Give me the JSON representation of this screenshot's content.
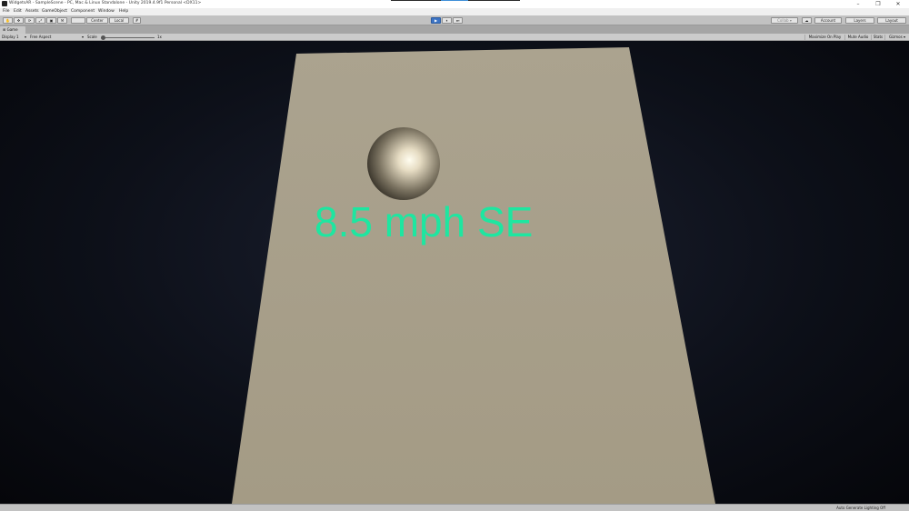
{
  "window": {
    "title": "WidgetsAR - SampleScene - PC, Mac & Linux Standalone - Unity 2019.4.9f1 Personal <DX11>",
    "controls": [
      "–",
      "❐",
      "✕"
    ]
  },
  "menu": [
    "File",
    "Edit",
    "Assets",
    "GameObject",
    "Component",
    "Window",
    "Help"
  ],
  "toolbar": {
    "tools": [
      "✋",
      "✥",
      "⟳",
      "⤢",
      "▣",
      "⚒"
    ],
    "pivot_label": "Center",
    "space_label": "Local",
    "snap_label": "#",
    "play_controls": [
      "▶",
      "⏸",
      "⏭"
    ],
    "collab_label": "Collab ▾",
    "cloud_icon": "cloud-icon",
    "account_label": "Account",
    "layers_label": "Layers",
    "layout_label": "Layout"
  },
  "tab": {
    "label": "Game"
  },
  "game_bar": {
    "display": "Display 1",
    "aspect": "Free Aspect",
    "scale_label": "Scale",
    "scale_value": "1x",
    "maximize": "Maximize On Play",
    "mute": "Mute Audio",
    "stats": "Stats",
    "gizmos": "Gizmos"
  },
  "scene": {
    "overlay_text": "8.5 mph SE"
  },
  "status": {
    "text": "Auto Generate Lighting Off"
  },
  "colors": {
    "overlay_text": "#1ee6a0",
    "plane": "#a79f8a",
    "play_active": "#3d74c4"
  }
}
